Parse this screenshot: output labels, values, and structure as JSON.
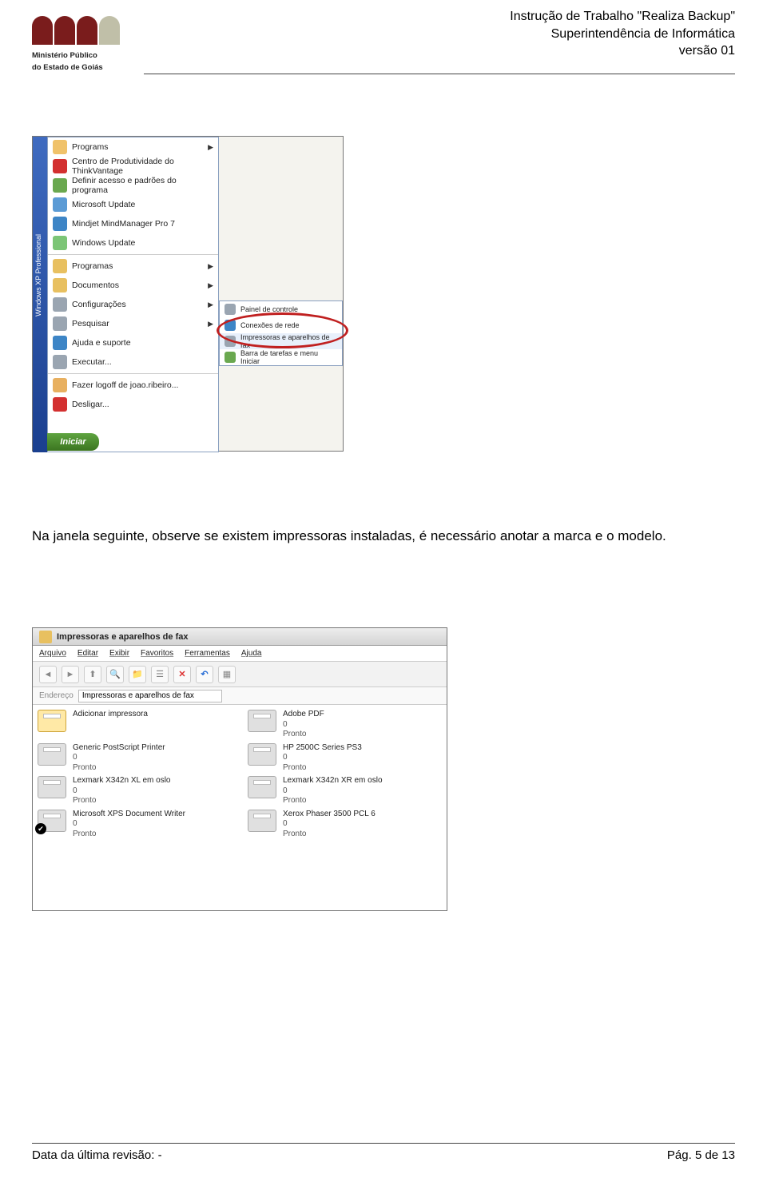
{
  "header": {
    "line1": "Instrução de Trabalho \"Realiza Backup\"",
    "line2": "Superintendência de Informática",
    "line3": "versão 01",
    "logo_line1": "Ministério Público",
    "logo_line2": "do Estado de Goiás"
  },
  "start_menu": {
    "xp_strip": "Windows XP  Professional",
    "items_top": [
      {
        "label": "Programs",
        "icon": "#f0c26a",
        "arrow": true
      },
      {
        "label": "Centro de Produtividade do ThinkVantage",
        "icon": "#d33030"
      },
      {
        "label": "Definir acesso e padrões do programa",
        "icon": "#6aa84f"
      },
      {
        "label": "Microsoft Update",
        "icon": "#5b9bd5"
      },
      {
        "label": "Mindjet MindManager Pro 7",
        "icon": "#3d85c6"
      },
      {
        "label": "Windows Update",
        "icon": "#7cc576"
      }
    ],
    "items_mid": [
      {
        "label": "Programas",
        "icon": "#e8c060",
        "arrow": true
      },
      {
        "label": "Documentos",
        "icon": "#e8c060",
        "arrow": true
      },
      {
        "label": "Configurações",
        "icon": "#9aa5b1",
        "arrow": true
      },
      {
        "label": "Pesquisar",
        "icon": "#9aa5b1",
        "arrow": true
      },
      {
        "label": "Ajuda e suporte",
        "icon": "#3d85c6"
      },
      {
        "label": "Executar...",
        "icon": "#9aa5b1"
      }
    ],
    "items_bottom": [
      {
        "label": "Fazer logoff de joao.ribeiro...",
        "icon": "#e8b060"
      },
      {
        "label": "Desligar...",
        "icon": "#d33030"
      }
    ],
    "submenu": [
      {
        "label": "Painel de controle",
        "icon": "#9aa5b1"
      },
      {
        "label": "Conexões de rede",
        "icon": "#3d85c6"
      },
      {
        "label": "Impressoras e aparelhos de fax",
        "icon": "#9aa5b1",
        "highlight": true
      },
      {
        "label": "Barra de tarefas e menu Iniciar",
        "icon": "#6aa84f"
      }
    ],
    "start_label": "Iniciar"
  },
  "body_paragraph": "Na janela seguinte, observe se existem impressoras instaladas, é necessário anotar a marca e o modelo.",
  "printers_window": {
    "title": "Impressoras e aparelhos de fax",
    "menu": [
      "Arquivo",
      "Editar",
      "Exibir",
      "Favoritos",
      "Ferramentas",
      "Ajuda"
    ],
    "address_label": "Endereço",
    "address_value": "Impressoras e aparelhos de fax",
    "printers": [
      {
        "name": "Adicionar impressora",
        "count": "",
        "status": "",
        "add": true
      },
      {
        "name": "Adobe PDF",
        "count": "0",
        "status": "Pronto"
      },
      {
        "name": "Generic PostScript Printer",
        "count": "0",
        "status": "Pronto"
      },
      {
        "name": "HP 2500C Series PS3",
        "count": "0",
        "status": "Pronto"
      },
      {
        "name": "Lexmark X342n XL em oslo",
        "count": "0",
        "status": "Pronto"
      },
      {
        "name": "Lexmark X342n XR em oslo",
        "count": "0",
        "status": "Pronto"
      },
      {
        "name": "Microsoft XPS Document Writer",
        "count": "0",
        "status": "Pronto",
        "check": true
      },
      {
        "name": "Xerox Phaser 3500 PCL 6",
        "count": "0",
        "status": "Pronto"
      }
    ]
  },
  "footer": {
    "left": "Data da última revisão: -",
    "right": "Pág. 5 de 13"
  }
}
